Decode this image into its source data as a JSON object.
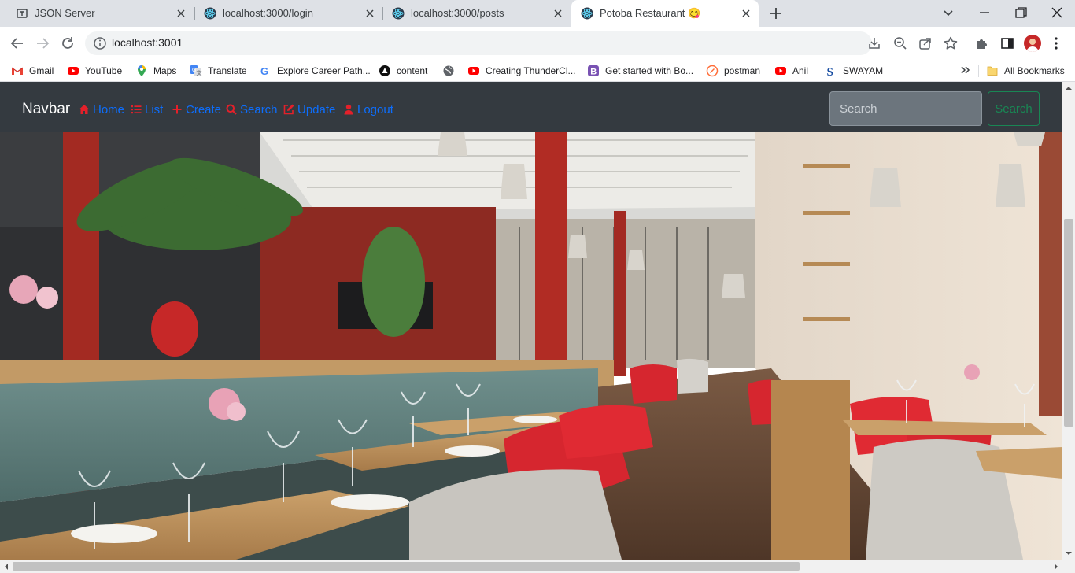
{
  "browser": {
    "tabs": [
      {
        "title": "JSON Server",
        "icon": "json-server-icon",
        "active": false
      },
      {
        "title": "localhost:3000/login",
        "icon": "react-icon",
        "active": false
      },
      {
        "title": "localhost:3000/posts",
        "icon": "react-icon",
        "active": false
      },
      {
        "title": "Potoba Restaurant 😋",
        "icon": "react-icon",
        "active": true
      }
    ],
    "url": "localhost:3001",
    "bookmarks": [
      {
        "label": "Gmail",
        "icon": "gmail-icon"
      },
      {
        "label": "YouTube",
        "icon": "youtube-icon"
      },
      {
        "label": "Maps",
        "icon": "maps-icon"
      },
      {
        "label": "Translate",
        "icon": "translate-icon"
      },
      {
        "label": "Explore Career Path...",
        "icon": "google-icon"
      },
      {
        "label": "content",
        "icon": "content-icon"
      },
      {
        "label": "",
        "icon": "globe-icon"
      },
      {
        "label": "Creating ThunderCl...",
        "icon": "youtube-icon"
      },
      {
        "label": "Get started with Bo...",
        "icon": "bootstrap-icon"
      },
      {
        "label": "postman",
        "icon": "postman-icon"
      },
      {
        "label": "Anil",
        "icon": "youtube-icon"
      },
      {
        "label": "SWAYAM",
        "icon": "swayam-icon"
      }
    ],
    "all_bookmarks": "All Bookmarks"
  },
  "navbar": {
    "brand": "Navbar",
    "links": [
      {
        "label": "Home",
        "icon": "home-icon"
      },
      {
        "label": "List",
        "icon": "list-icon"
      },
      {
        "label": "Create",
        "icon": "plus-icon"
      },
      {
        "label": "Search",
        "icon": "search-icon"
      },
      {
        "label": "Update",
        "icon": "edit-icon"
      },
      {
        "label": "Logout",
        "icon": "user-icon"
      }
    ],
    "search_placeholder": "Search",
    "search_button": "Search"
  },
  "colors": {
    "navbar_bg": "#343a40",
    "link": "#0d6efd",
    "icon_red": "#e4202a",
    "search_button": "#198754"
  },
  "hero": {
    "subject": "restaurant interior photo"
  }
}
